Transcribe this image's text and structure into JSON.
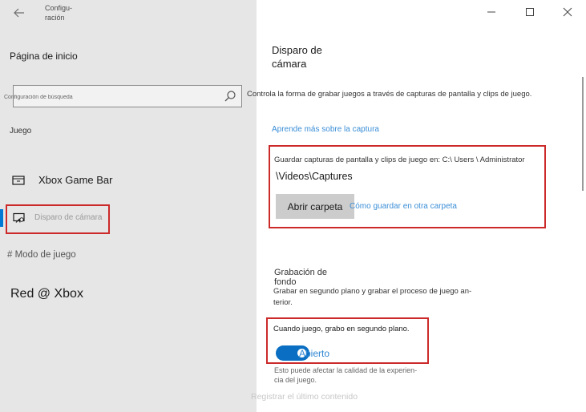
{
  "window": {
    "app_title": "Configu-\nración",
    "controls": {
      "minimize_icon": "minimize-icon",
      "maximize_icon": "maximize-icon",
      "close_icon": "close-icon"
    }
  },
  "nav": {
    "back_icon": "back-arrow-icon",
    "home_label": "Página de inicio",
    "search": {
      "placeholder": "Configuración de búsqueda",
      "value": "",
      "icon": "search-icon"
    },
    "group_heading": "Juego",
    "items": [
      {
        "label": "Xbox Game Bar",
        "icon": "xbox-game-bar-icon",
        "selected": false
      },
      {
        "label": "Disparo de cámara",
        "icon": "captures-icon",
        "selected": true
      },
      {
        "label": "# Modo de juego",
        "icon": "game-mode-icon",
        "selected": false
      },
      {
        "label": "Red @ Xbox",
        "icon": "xbox-network-icon",
        "selected": false
      }
    ]
  },
  "main": {
    "title": "Disparo de\ncámara",
    "description": "Controla la forma de grabar juegos a través de capturas de pantalla y clips de juego.",
    "learn_more_link": "Aprende más sobre la captura",
    "save_location_text": "Guardar capturas de pantalla y clips de juego en: C:\\ Users \\ Administrator",
    "save_location_path": "\\Videos\\Captures",
    "open_folder_button": "Abrir carpeta",
    "other_folder_link": "Cómo guardar en otra carpeta",
    "background_recording": {
      "title": "Grabación de\nfondo",
      "description": "Grabar en segundo plano y grabar el proceso de juego an-\nterior.",
      "toggle_label": "Cuando juego, grabo en segundo plano.",
      "toggle_state": "Abierto",
      "toggle_on": true,
      "performance_note": "Esto puede afectar la calidad de la experien-\ncia del juego."
    },
    "record_last_label": "Registrar el último contenido"
  },
  "colors": {
    "accent": "#0078d4",
    "link": "#3a8ed6",
    "highlight_box": "#cc2a2a",
    "nav_background": "#e6e6e6",
    "toggle_on": "#0a6fc2"
  }
}
